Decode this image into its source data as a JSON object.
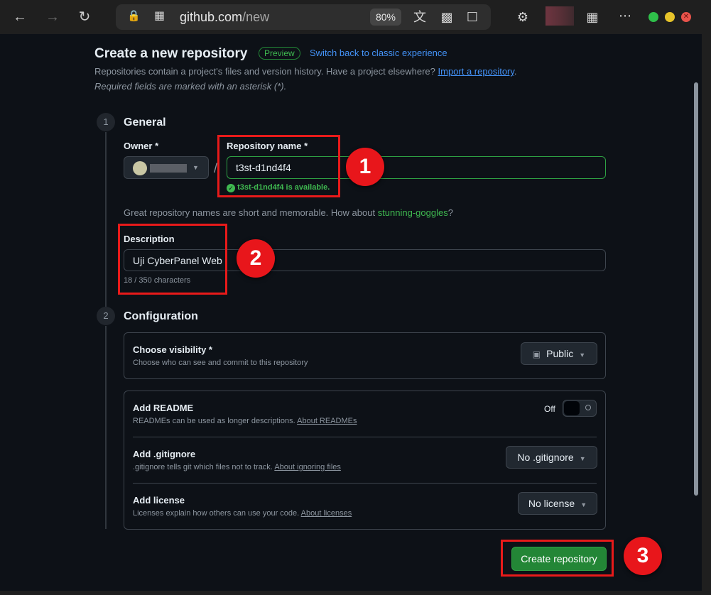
{
  "browser": {
    "url_host": "github.com",
    "url_path": "/new",
    "zoom": "80%"
  },
  "header": {
    "title": "Create a new repository",
    "badge": "Preview",
    "switch_link": "Switch back to classic experience",
    "description_prefix": "Repositories contain a project's files and version history. Have a project elsewhere?",
    "import_link": "Import a repository",
    "description_suffix": ".",
    "required_note": "Required fields are marked with an asterisk (*)."
  },
  "general": {
    "step_number": "1",
    "title": "General",
    "owner_label": "Owner *",
    "slash": "/",
    "repo_name_label": "Repository name *",
    "repo_name_value": "t3st-d1nd4f4",
    "availability": "t3st-d1nd4f4 is available.",
    "suggestion_prefix": "Great repository names are short and memorable. How about",
    "suggestion_name": "stunning-goggles",
    "suggestion_suffix": "?",
    "description_label": "Description",
    "description_value": "Uji CyberPanel Web",
    "char_count": "18 / 350 characters"
  },
  "configuration": {
    "step_number": "2",
    "title": "Configuration",
    "visibility_label": "Choose visibility *",
    "visibility_desc": "Choose who can see and commit to this repository",
    "visibility_value": "Public",
    "readme_label": "Add README",
    "readme_desc": "READMEs can be used as longer descriptions.",
    "readme_link": "About READMEs",
    "readme_toggle": "Off",
    "gitignore_label": "Add .gitignore",
    "gitignore_desc": ".gitignore tells git which files not to track.",
    "gitignore_link": "About ignoring files",
    "gitignore_value": "No .gitignore",
    "license_label": "Add license",
    "license_desc": "Licenses explain how others can use your code.",
    "license_link": "About licenses",
    "license_value": "No license"
  },
  "submit": {
    "label": "Create repository"
  },
  "annotations": {
    "one": "1",
    "two": "2",
    "three": "3"
  }
}
